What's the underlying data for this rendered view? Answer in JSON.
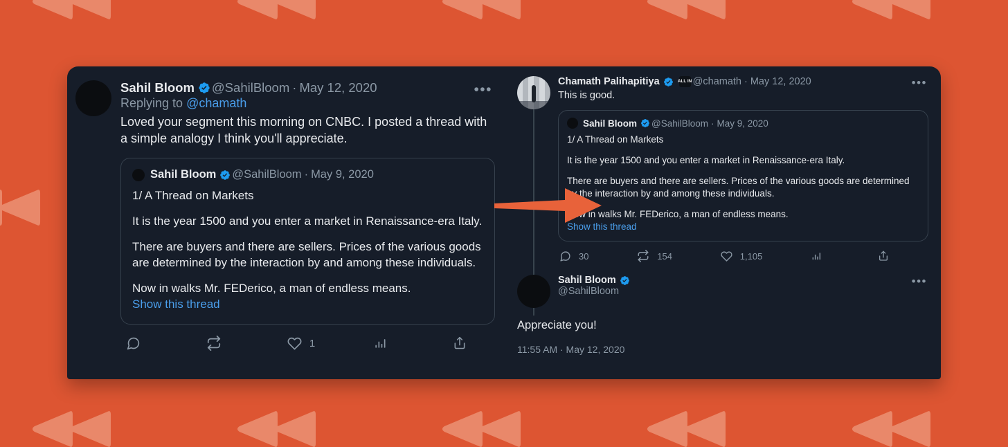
{
  "theme": {
    "background_color": "#dd5532",
    "pattern_color": "#e9886a",
    "card_background": "#161d29",
    "text_primary": "#e8eaed",
    "text_muted": "#8b98a5",
    "link_color": "#4a9eeb",
    "verified_badge_color": "#1d9bf0",
    "arrow_color": "#e8623a",
    "quote_border_color": "#36414d"
  },
  "left_panel": {
    "tweet": {
      "display_name": "Sahil Bloom",
      "verified": true,
      "handle": "@SahilBloom",
      "separator": "·",
      "date": "May 12, 2020",
      "more_label": "•••",
      "replying_prefix": "Replying to ",
      "replying_mention": "@chamath",
      "body": "Loved your segment this morning on CNBC. I posted a thread with a simple analogy I think you'll appreciate."
    },
    "quoted_tweet": {
      "display_name": "Sahil Bloom",
      "verified": true,
      "handle": "@SahilBloom",
      "separator": "·",
      "date": "May 9, 2020",
      "paragraphs": [
        "1/ A Thread on Markets",
        "It is the year 1500 and you enter a market in Renaissance-era Italy.",
        "There are buyers and there are sellers. Prices of the various goods are determined by the interaction by and among these individuals.",
        "Now in walks Mr. FEDerico, a man of endless means."
      ],
      "show_thread_label": "Show this thread"
    },
    "actions": {
      "reply_count": "",
      "retweet_count": "",
      "like_count": "1",
      "analytics_count": "",
      "share_count": ""
    }
  },
  "right_panel": {
    "tweet": {
      "display_name": "Chamath Palihapitiya",
      "verified": true,
      "affiliate_badge": "ALL IN",
      "handle": "@chamath",
      "separator": "·",
      "date": "May 12, 2020",
      "more_label": "•••",
      "body": "This is good."
    },
    "quoted_tweet": {
      "display_name": "Sahil Bloom",
      "verified": true,
      "handle": "@SahilBloom",
      "separator": "·",
      "date": "May 9, 2020",
      "paragraphs": [
        "1/ A Thread on Markets",
        "It is the year 1500 and you enter a market in Renaissance-era Italy.",
        "There are buyers and there are sellers. Prices of the various goods are determined by the interaction by and among these individuals.",
        "Now in walks Mr. FEDerico, a man of endless means."
      ],
      "show_thread_label": "Show this thread"
    },
    "actions": {
      "reply_count": "30",
      "retweet_count": "154",
      "like_count": "1,105",
      "analytics_count": "",
      "share_count": ""
    },
    "reply_tweet": {
      "display_name": "Sahil Bloom",
      "verified": true,
      "handle": "@SahilBloom",
      "more_label": "•••",
      "body": "Appreciate you!",
      "timestamp": "11:55 AM · May 12, 2020"
    }
  },
  "annotation": {
    "arrow_name": "right-pointing-arrow",
    "arrow_direction": "right"
  },
  "icons": {
    "reply": "reply-icon",
    "retweet": "retweet-icon",
    "like": "heart-icon",
    "analytics": "bar-chart-icon",
    "share": "share-icon",
    "verified": "verified-badge-icon",
    "more": "more-options-icon"
  }
}
